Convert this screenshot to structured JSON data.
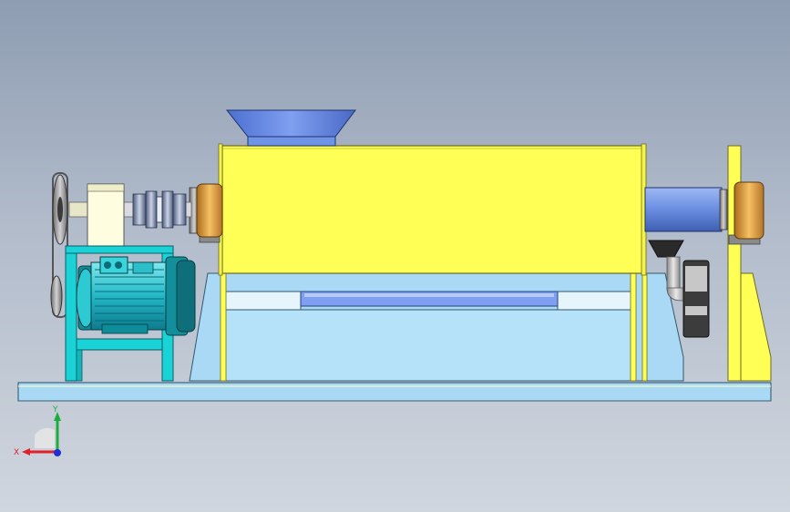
{
  "colors": {
    "background_top": "#8e9db2",
    "background_bottom": "#d0d6de",
    "housing_yellow": "#ffff55",
    "base_light_blue": "#a9d9f5",
    "motor_frame_cyan": "#19d3d6",
    "shaft_blue": "#6f94e6",
    "bearing_orange": "#f0b04a",
    "axis_x": "#e0202a",
    "axis_y": "#1cae3c",
    "axis_z": "#1d2fd6"
  },
  "triad": {
    "x_label": "X",
    "y_label": "Y"
  },
  "icons": {
    "triad": "coordinate-triad-icon"
  }
}
